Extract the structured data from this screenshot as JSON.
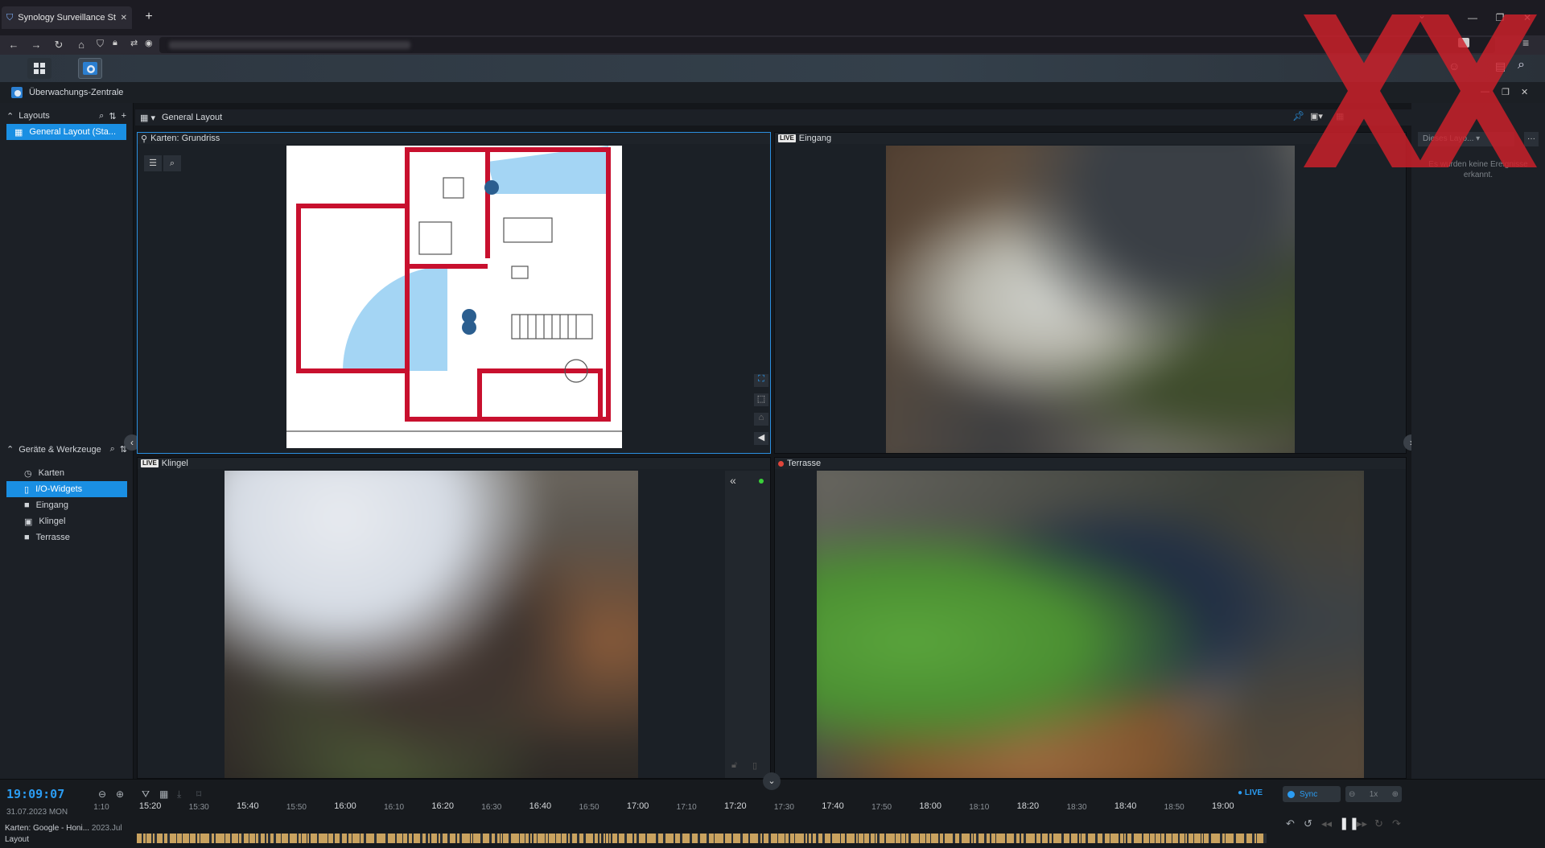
{
  "browser": {
    "tab_title": "Synology Surveillance Station -",
    "new_tab": "+",
    "minimize": "—",
    "restore": "❐",
    "close": "✕",
    "tab_close": "✕"
  },
  "app": {
    "title": "Überwachungs-Zentrale",
    "win_min": "—",
    "win_restore": "❐",
    "win_close": "✕"
  },
  "sidebar": {
    "layouts_label": "Layouts",
    "layout_items": [
      {
        "label": "General Layout (Sta..."
      }
    ],
    "devices_label": "Geräte & Werkzeuge",
    "device_items": [
      {
        "label": "Karten",
        "icon": "map-icon"
      },
      {
        "label": "I/O-Widgets",
        "icon": "io-icon",
        "selected": true
      },
      {
        "label": "Eingang",
        "icon": "camera-icon"
      },
      {
        "label": "Klingel",
        "icon": "doorbell-icon"
      },
      {
        "label": "Terrasse",
        "icon": "camera-icon"
      }
    ]
  },
  "layout": {
    "title": "General Layout"
  },
  "cells": {
    "map": {
      "title": "Karten: Grundriss"
    },
    "eingang": {
      "title": "Eingang",
      "live": "LIVE"
    },
    "klingel": {
      "title": "Klingel",
      "live": "LIVE"
    },
    "terrasse": {
      "title": "Terrasse"
    }
  },
  "rightpanel": {
    "dropdown": "Dieses Layo...",
    "no_events": "Es wurden keine Ereignisse erkannt."
  },
  "timeline": {
    "clock": "19:09:07",
    "date": "31.07.2023 MON",
    "live": "● LIVE",
    "sync": "Sync",
    "speed": "1x",
    "layer1": "Karten: Google - Honi...",
    "layer1_extra": "2023.Jul",
    "layer2": "Layout",
    "ticks": [
      "1:10",
      "15:20",
      "15:30",
      "15:40",
      "15:50",
      "16:00",
      "16:10",
      "16:20",
      "16:30",
      "16:40",
      "16:50",
      "17:00",
      "17:10",
      "17:20",
      "17:30",
      "17:40",
      "17:50",
      "18:00",
      "18:10",
      "18:20",
      "18:30",
      "18:40",
      "18:50",
      "19:00"
    ]
  },
  "colors": {
    "accent": "#1a8fe3",
    "timeline_bar": "#c9a25f",
    "watermark": "#d0202a"
  }
}
